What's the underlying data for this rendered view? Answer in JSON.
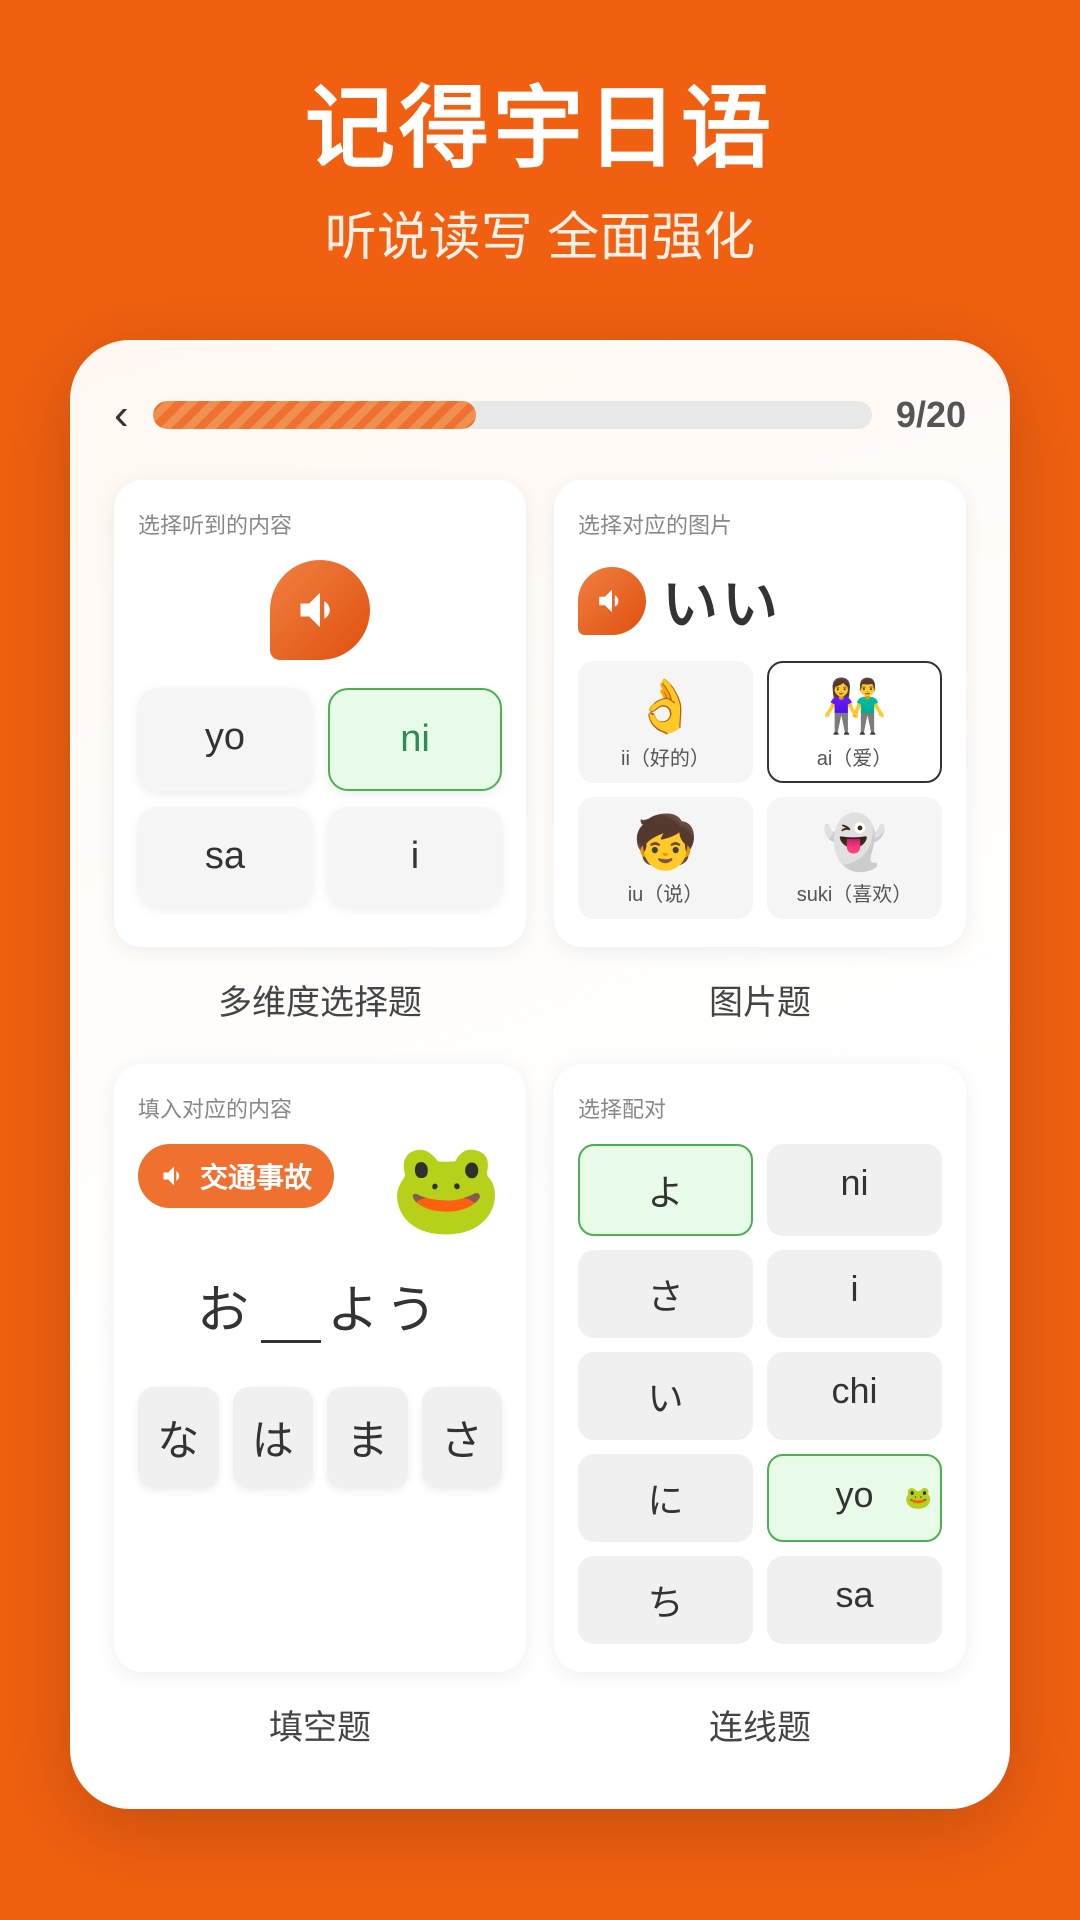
{
  "header": {
    "title": "记得宇日语",
    "subtitle": "听说读写 全面强化"
  },
  "progress": {
    "current": 9,
    "total": 20,
    "label": "9/20",
    "percent": 45
  },
  "back_button": "‹",
  "card1": {
    "label": "选择听到的内容",
    "choices": [
      {
        "text": "yo",
        "selected": false
      },
      {
        "text": "ni",
        "selected": true
      },
      {
        "text": "sa",
        "selected": false
      },
      {
        "text": "i",
        "selected": false
      }
    ]
  },
  "card2": {
    "label": "选择对应的图片",
    "jp_text": "いい",
    "options": [
      {
        "emoji": "👌",
        "label": "ii（好的）",
        "selected": false
      },
      {
        "emoji": "👫",
        "label": "ai（爱）",
        "selected": true
      },
      {
        "emoji": "🧒",
        "label": "iu（说）",
        "selected": false
      },
      {
        "emoji": "👻",
        "label": "suki（喜欢）",
        "selected": false
      }
    ]
  },
  "card3": {
    "label": "填入对应的内容",
    "audio_word": "交通事故",
    "sentence": "お＿＿よう",
    "kana_choices": [
      "な",
      "は",
      "ま",
      "さ"
    ],
    "bottom_label": "填空题"
  },
  "card4": {
    "label": "选择配对",
    "left": [
      "よ",
      "さ",
      "い",
      "に",
      "ち"
    ],
    "right": [
      "ni",
      "i",
      "chi",
      "yo",
      "sa"
    ],
    "selected_left": "よ",
    "selected_right": "yo",
    "bottom_label": "连线题"
  },
  "labels": {
    "multidim": "多维度选择题",
    "picture": "图片题",
    "fill": "填空题",
    "match": "连线题"
  }
}
